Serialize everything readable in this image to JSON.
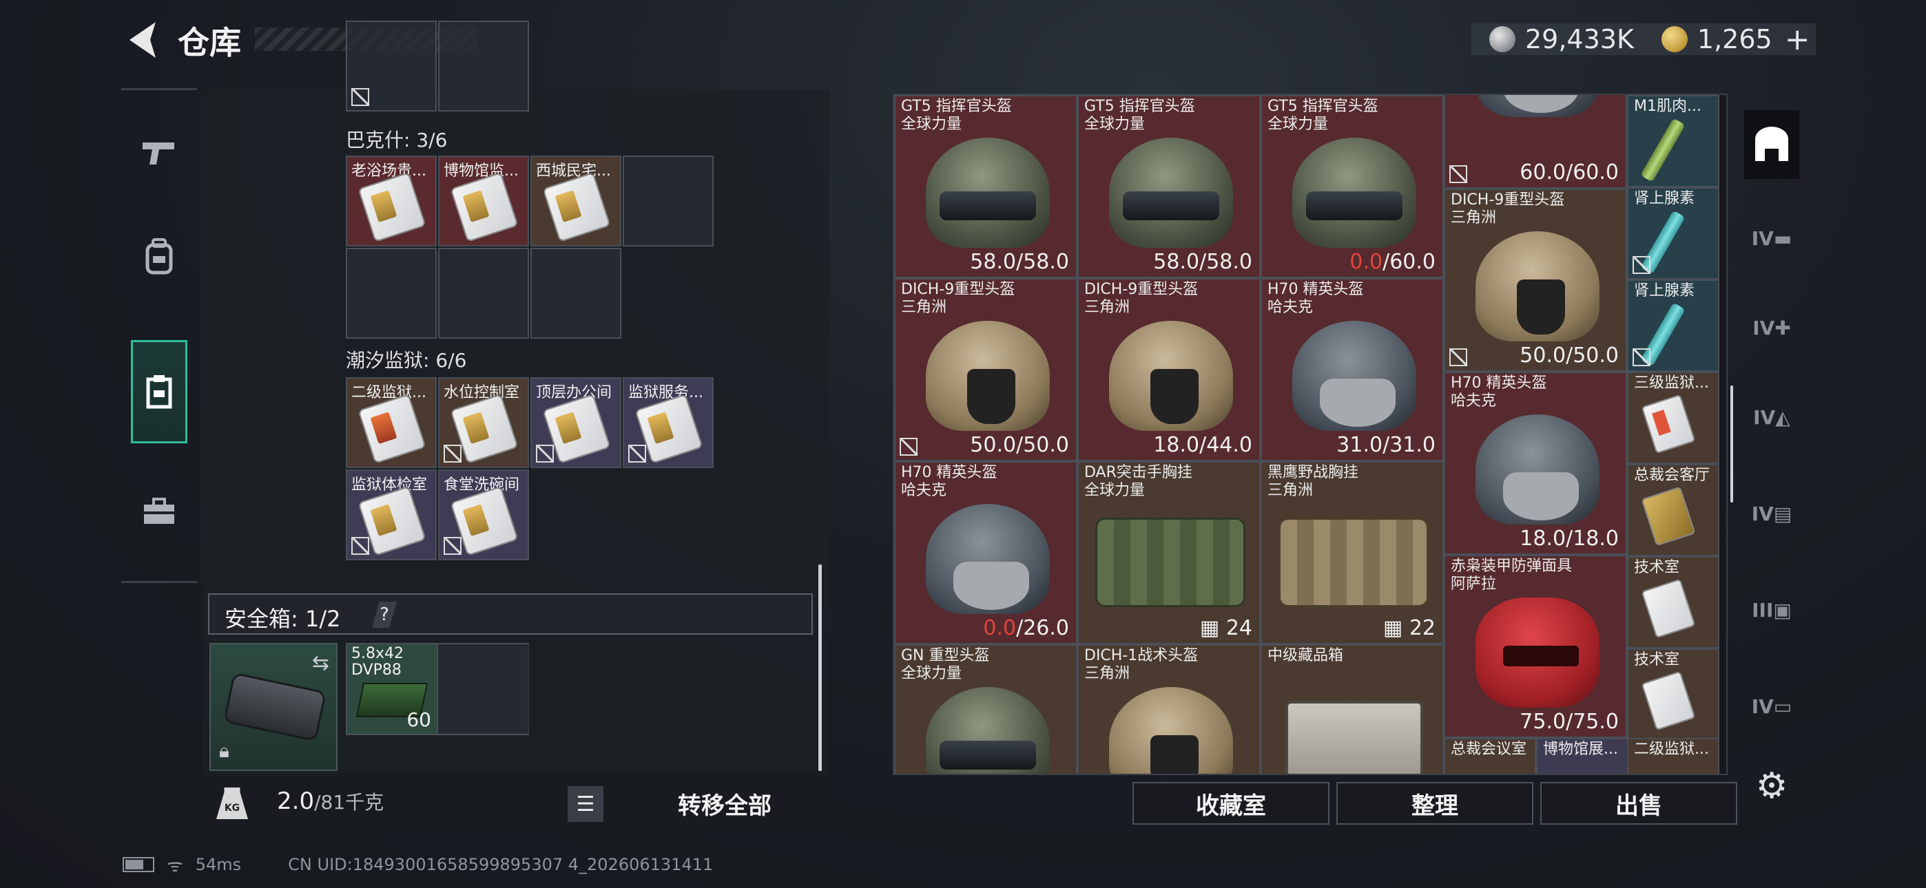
{
  "header": {
    "title": "仓库",
    "currency_silver": "29,433K",
    "currency_gold": "1,265",
    "plus_label": "+"
  },
  "stash": {
    "group_bakshi": "巴克什: 3/6",
    "bakshi_items": [
      "老浴场贵...",
      "博物馆监...",
      "西城民宅..."
    ],
    "group_prison": "潮汐监狱: 6/6",
    "prison_items": [
      "二级监狱...",
      "水位控制室",
      "顶层办公间",
      "监狱服务...",
      "监狱体检室",
      "食堂洗碗间"
    ],
    "safebox_label": "安全箱: 1/2",
    "help_label": "?",
    "ammo_name": "5.8x42 DVP88",
    "ammo_count": "60",
    "weight_icon_label": "KG",
    "weight_value": "2.0",
    "weight_max": "/81千克",
    "transfer_all": "转移全部"
  },
  "status": {
    "ping": "54ms",
    "uid": "CN UID:18493001658599895307 4_202606131411"
  },
  "inventory": {
    "cells": [
      {
        "name": "GT5 指挥官头盔",
        "sub": "全球力量",
        "cur": "58.0",
        "max": "/58.0"
      },
      {
        "name": "GT5 指挥官头盔",
        "sub": "全球力量",
        "cur": "58.0",
        "max": "/58.0"
      },
      {
        "name": "GT5 指挥官头盔",
        "sub": "全球力量",
        "cur": "0.0",
        "max": "/60.0"
      },
      {
        "name": "",
        "sub": "",
        "cur": "60.0",
        "max": "/60.0"
      },
      {
        "name": "DICH-9重型头盔",
        "sub": "三角洲",
        "cur": "50.0",
        "max": "/50.0"
      },
      {
        "name": "DICH-9重型头盔",
        "sub": "三角洲",
        "cur": "50.0",
        "max": "/50.0"
      },
      {
        "name": "DICH-9重型头盔",
        "sub": "三角洲",
        "cur": "18.0",
        "max": "/44.0"
      },
      {
        "name": "H70 精英头盔",
        "sub": "哈夫克",
        "cur": "31.0",
        "max": "/31.0"
      },
      {
        "name": "H70 精英头盔",
        "sub": "哈夫克",
        "cur": "18.0",
        "max": "/18.0"
      },
      {
        "name": "H70 精英头盔",
        "sub": "哈夫克",
        "cur": "0.0",
        "max": "/26.0"
      },
      {
        "name": "DAR突击手胸挂",
        "sub": "全球力量",
        "capacity": "24"
      },
      {
        "name": "黑鹰野战胸挂",
        "sub": "三角洲",
        "capacity": "22"
      },
      {
        "name": "赤枭装甲防弹面具",
        "sub": "阿萨拉",
        "cur": "75.0",
        "max": "/75.0"
      },
      {
        "name": "GN 重型头盔",
        "sub": "全球力量"
      },
      {
        "name": "DICH-1战术头盔",
        "sub": "三角洲"
      },
      {
        "name": "中级藏品箱",
        "sub": ""
      }
    ],
    "small": [
      "M1肌肉...",
      "肾上腺素",
      "肾上腺素",
      "三级监狱...",
      "总裁会客厅",
      "技术室",
      "技术室"
    ],
    "bottom_row": [
      "总裁会议室",
      "博物馆展...",
      "二级监狱..."
    ]
  },
  "tabs": {
    "tier4": "IV",
    "tier3": "III"
  },
  "actions": {
    "collection": "收藏室",
    "organize": "整理",
    "sell": "出售"
  },
  "colors": {
    "accent": "#2fbf9a",
    "broken": "#e0453c",
    "red_rarity": "#562a2e",
    "orange_rarity": "#4a3a2f",
    "purple_rarity": "#3e3a52"
  }
}
